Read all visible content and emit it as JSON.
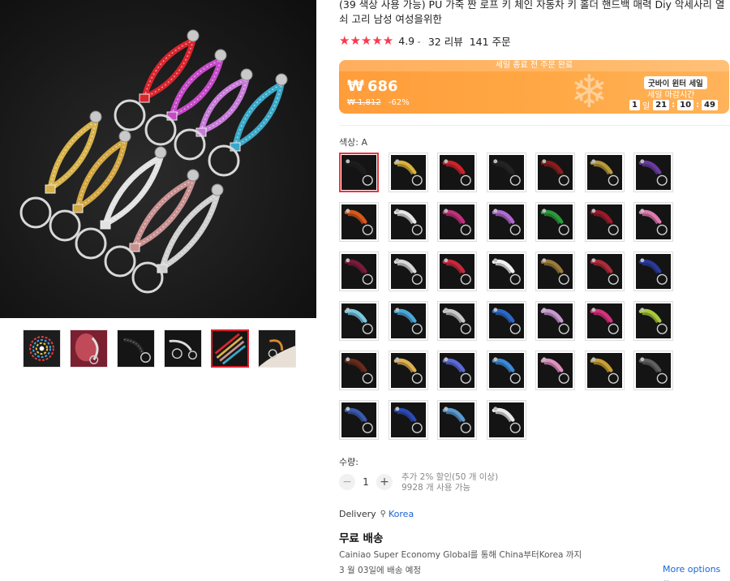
{
  "product": {
    "title": "(39 색상 사용 가능) PU 가죽 짠 로프 키 체인 자동차 키 홀더 핸드백 매력 Diy 악세사리 열쇠 고리 남성 여성을위한",
    "rating": "4.9",
    "stars": "★★★★★",
    "caret": "⌄",
    "reviews": "32 리뷰",
    "orders": "141 주문"
  },
  "promo": {
    "banner": "세일 종료 전 주문 완료",
    "currency": "₩",
    "price": "686",
    "original_price": "₩ 1,812",
    "discount": "-62%",
    "snowflake": "❄",
    "sale_badge": "굿바이 윈터 세일",
    "sale_end_label": "세일 마감시간",
    "timer": {
      "days": "1",
      "day_unit": "일",
      "hours": "21",
      "minutes": "10",
      "seconds": "49",
      "sep": ":"
    }
  },
  "variants": {
    "label": "색상: A",
    "selected_index": 0,
    "colors": [
      "#1c1c1c",
      "#d8b23a",
      "#d0212b",
      "#242424",
      "#8a1c1c",
      "#b89a3a",
      "#6a3aa0",
      "#d9571a",
      "#e6e6e6",
      "#c0307a",
      "#b06ad0",
      "#2a9a3a",
      "#9a1a2a",
      "#e07ab0",
      "#7a1a3a",
      "#d8d8d8",
      "#c8283a",
      "#f2f2f2",
      "#9a7a3a",
      "#b02a3a",
      "#2a3a9a",
      "#78c8e0",
      "#4aa8d8",
      "#c8c8c8",
      "#2a68c8",
      "#c898d0",
      "#d8307a",
      "#a8c83a",
      "#6a2a1a",
      "#e0b050",
      "#5a6ad8",
      "#3a8ad8",
      "#e090c0",
      "#c8a030",
      "#606060",
      "#3a5ab0",
      "#2a4ab8",
      "#5a9ad0",
      "#eaeaea"
    ]
  },
  "quantity": {
    "label": "수량:",
    "minus": "−",
    "plus": "+",
    "value": "1",
    "discount_note": "추가 2% 할인(50 개 이상)",
    "stock_note": "9928 개 사용 가능"
  },
  "delivery": {
    "label": "Delivery",
    "pin_icon": "⚲",
    "location": "Korea",
    "title": "무료 배송",
    "service": "Cainiao Super Economy Global를 통해 China부터Korea 까지",
    "eta": "3 월 03일에 배송 예정",
    "more": "More options ⌄"
  },
  "gallery": {
    "main_strap_colors": [
      "#d9262f",
      "#c64ac8",
      "#c77ad8",
      "#3aa8c8",
      "#d6b24a",
      "#d2a640",
      "#e2e2e2",
      "#c89090",
      "#cfcfcf"
    ],
    "thumbnail_count": 6,
    "selected_thumbnail": 4
  }
}
